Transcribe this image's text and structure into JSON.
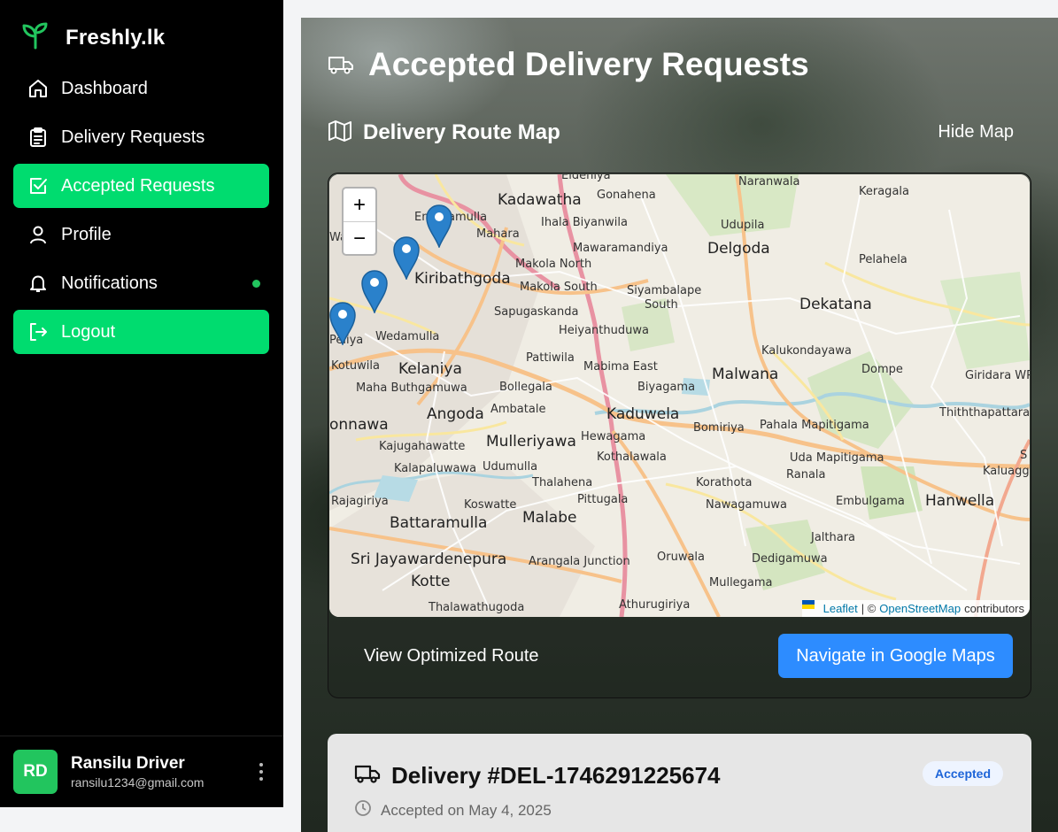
{
  "brand": {
    "name": "Freshly.lk",
    "icon": "sprout-icon",
    "icon_color": "#22c55e"
  },
  "sidebar": {
    "items": [
      {
        "label": "Dashboard",
        "icon": "home-icon",
        "active": false
      },
      {
        "label": "Delivery Requests",
        "icon": "clipboard-icon",
        "active": false
      },
      {
        "label": "Accepted Requests",
        "icon": "check-square-icon",
        "active": true
      },
      {
        "label": "Profile",
        "icon": "user-icon",
        "active": false
      },
      {
        "label": "Notifications",
        "icon": "bell-icon",
        "active": false,
        "has_dot": true
      },
      {
        "label": "Logout",
        "icon": "logout-icon",
        "active": true
      }
    ],
    "active_color": "#00dc6f"
  },
  "user": {
    "initials": "RD",
    "name": "Ransilu Driver",
    "email": "ransilu1234@gmail.com"
  },
  "main": {
    "title": "Accepted Delivery Requests",
    "map_section": {
      "title": "Delivery Route Map",
      "hide_label": "Hide Map",
      "zoom_in": "+",
      "zoom_out": "−",
      "attribution": {
        "leaflet": "Leaflet",
        "separator": "| ©",
        "osm": "OpenStreetMap",
        "suffix": "contributors"
      },
      "labels": {
        "eldeniya": "Eldeniya",
        "kadawatha": "Kadawatha",
        "gonahena": "Gonahena",
        "naranwala": "Naranwala",
        "keragala": "Keragala",
        "enderamulla": "Enderamulla",
        "wa": "Wa",
        "mahara": "Mahara",
        "ihala_biyanwila": "Ihala Biyanwila",
        "udupila": "Udupila",
        "mawaramandiya": "Mawaramandiya",
        "delgoda": "Delgoda",
        "makola_north": "Makola North",
        "pelahela": "Pelahela",
        "kiribathgoda": "Kiribathgoda",
        "makola_south": "Makola South",
        "siyambalape": "Siyambalape",
        "south": "South",
        "dekatana": "Dekatana",
        "sapugaskanda": "Sapugaskanda",
        "peliya": "Peliya",
        "wedamulla": "Wedamulla",
        "heiyanthuduwa": "Heiyanthuduwa",
        "kalukondayawa": "Kalukondayawa",
        "pattiwila": "Pattiwila",
        "kotuwila": "Kotuwila",
        "kelaniya": "Kelaniya",
        "mabima_east": "Mabima East",
        "malwana": "Malwana",
        "dompe": "Dompe",
        "giridara_wp": "Giridara WP",
        "maha_buthgamuwa": "Maha Buthgamuwa",
        "bollegala": "Bollegala",
        "biyagama": "Biyagama",
        "onnawa": "onnawa",
        "angoda": "Angoda",
        "ambatale": "Ambatale",
        "kaduwela": "Kaduwela",
        "thiththapattara": "Thiththapattara",
        "kajugahawatte": "Kajugahawatte",
        "mulleriyawa": "Mulleriyawa",
        "hewagama": "Hewagama",
        "bomiriya": "Bomiriya",
        "pahala_mapitigama": "Pahala Mapitigama",
        "kalapaluwawa": "Kalapaluwawa",
        "udumulla": "Udumulla",
        "kothalawala": "Kothalawala",
        "uda_mapitigama": "Uda Mapitigama",
        "kaluagga": "Kaluagga",
        "thalahena": "Thalahena",
        "korathota": "Korathota",
        "ranala": "Ranala",
        "rajagiriya": "Rajagiriya",
        "koswatte": "Koswatte",
        "pittugala": "Pittugala",
        "nawagamuwa": "Nawagamuwa",
        "embulgama": "Embulgama",
        "hanwella": "Hanwella",
        "battaramulla": "Battaramulla",
        "malabe": "Malabe",
        "jalthara": "Jalthara",
        "sri_jayawardenepura": "Sri Jayawardenepura",
        "arangala_junction": "Arangala Junction",
        "oruwala": "Oruwala",
        "dedigamuwa": "Dedigamuwa",
        "kotte": "Kotte",
        "mullegama": "Mullegama",
        "thalawathugoda": "Thalawathugoda",
        "athurugiriya": "Athurugiriya",
        "s": "S"
      },
      "view_route_label": "View Optimized Route",
      "navigate_label": "Navigate in Google Maps",
      "marker_color": "#2a81cb"
    },
    "delivery": {
      "id_label": "Delivery #DEL-1746291225674",
      "status": "Accepted",
      "accepted_on": "Accepted on May 4, 2025"
    }
  }
}
